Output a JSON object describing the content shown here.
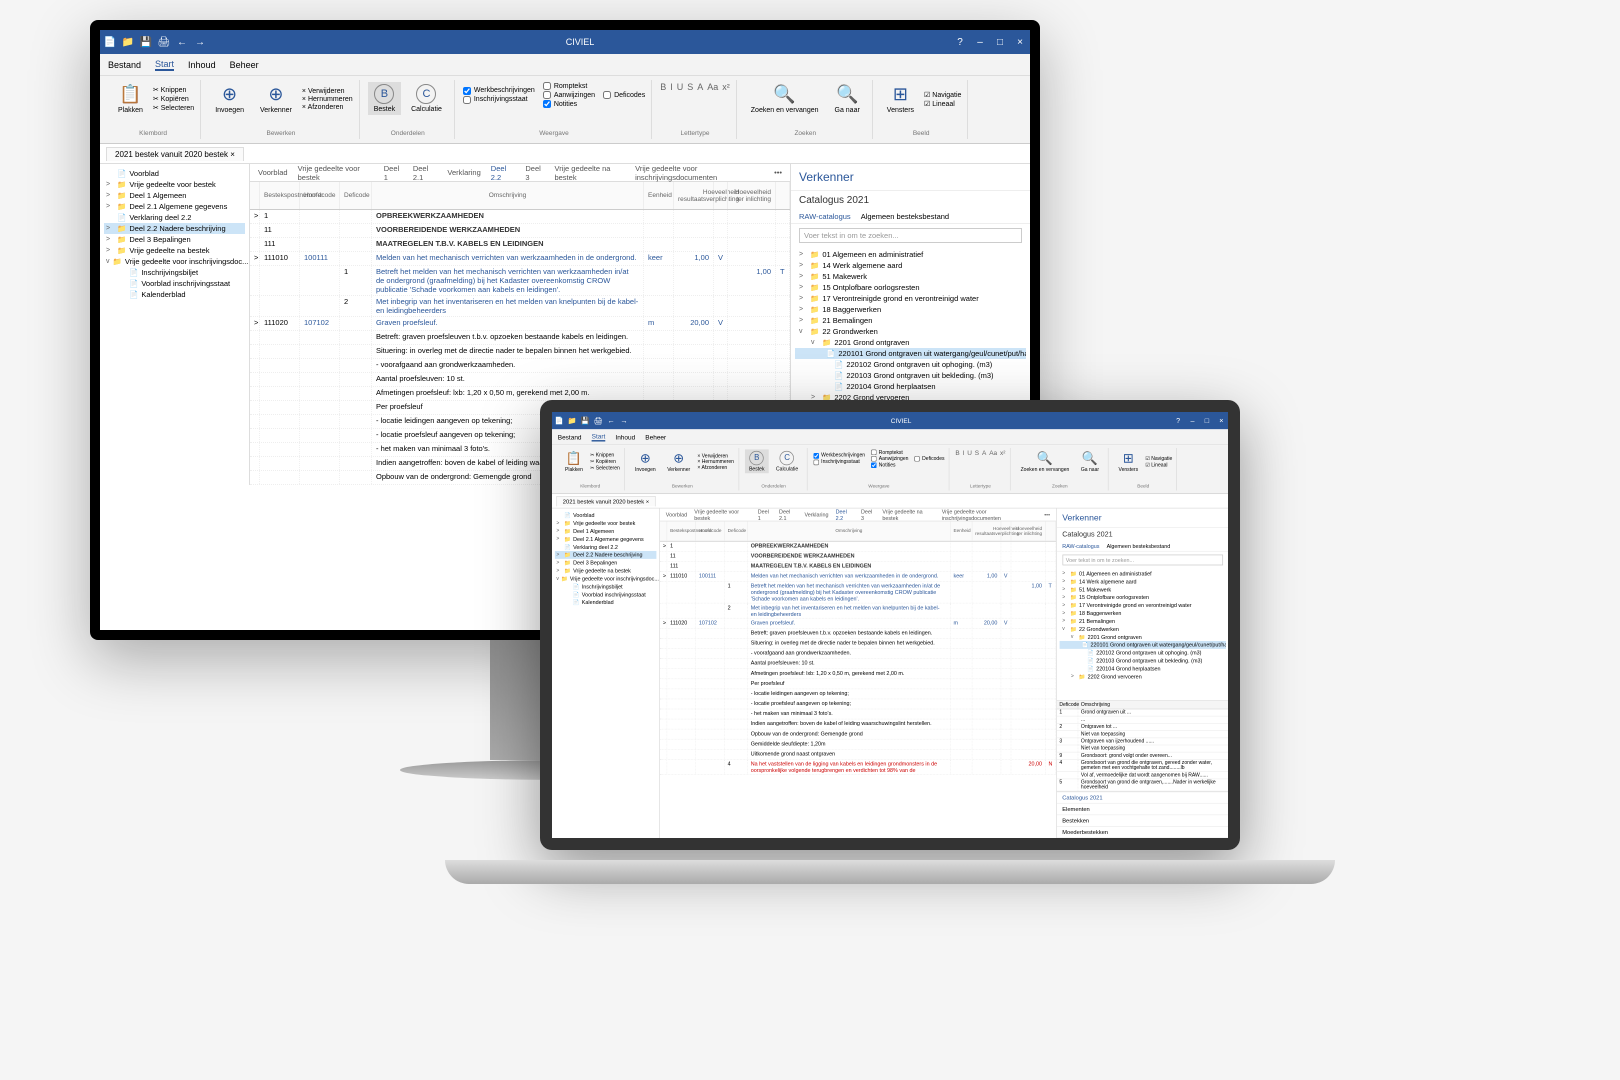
{
  "app_title": "CIVIEL",
  "titlebar_icons": [
    "file-icon",
    "folder-icon",
    "save-icon",
    "print-icon",
    "divider",
    "undo-icon",
    "redo-icon"
  ],
  "titlebar_right_icons": [
    "help-icon",
    "minimize-icon",
    "maximize-icon",
    "close-icon"
  ],
  "menu": {
    "items": [
      "Bestand",
      "Start",
      "Inhoud",
      "Beheer"
    ],
    "active": "Start"
  },
  "ribbon": {
    "groups": [
      {
        "name": "Klembord",
        "label": "Plakken",
        "items": [
          "Knippen",
          "Kopiëren",
          "Selecteren"
        ]
      },
      {
        "name": "Bewerken",
        "btns": [
          "Invoegen",
          "Verkenner"
        ],
        "items": [
          "Verwijderen",
          "Hernummeren",
          "Afzonderen"
        ]
      },
      {
        "name": "Onderdelen",
        "btns": [
          {
            "l": "Bestek",
            "circ": "B"
          },
          {
            "l": "Calculatie",
            "circ": "C"
          }
        ]
      },
      {
        "name": "Weergave",
        "checks_col1": [
          {
            "l": "Werkbeschrijvingen",
            "c": true
          },
          {
            "l": "Inschrijvingsstaat",
            "c": false
          }
        ],
        "checks_col2": [
          {
            "l": "Romptekst",
            "c": false
          },
          {
            "l": "Aanwijzingen",
            "c": false
          },
          {
            "l": "Notities",
            "c": true
          }
        ],
        "checks_col3": [
          {
            "l": "Deficodes",
            "c": false
          }
        ]
      },
      {
        "name": "Lettertype",
        "icons": [
          "B",
          "I",
          "U",
          "S",
          "A",
          "Aa",
          "x²"
        ]
      },
      {
        "name": "Zoeken",
        "btns": [
          "Zoeken en vervangen",
          "Ga naar"
        ]
      },
      {
        "name": "Beeld",
        "btn": "Vensters",
        "items": [
          "Navigatie",
          "Lineaal"
        ]
      }
    ]
  },
  "doc_tab": "2021 bestek vanuit 2020 bestek",
  "left_tree": [
    {
      "t": "Voorblad",
      "i": "file"
    },
    {
      "t": "Vrije gedeelte voor bestek",
      "i": "folder",
      "c": ">"
    },
    {
      "t": "Deel 1 Algemeen",
      "i": "folder",
      "c": ">"
    },
    {
      "t": "Deel 2.1 Algemene gegevens",
      "i": "folder",
      "c": ">"
    },
    {
      "t": "Verklaring deel 2.2",
      "i": "file"
    },
    {
      "t": "Deel 2.2 Nadere beschrijving",
      "i": "folder",
      "c": ">",
      "sel": true
    },
    {
      "t": "Deel 3 Bepalingen",
      "i": "folder",
      "c": ">"
    },
    {
      "t": "Vrije gedeelte na bestek",
      "i": "folder",
      "c": ">"
    },
    {
      "t": "Vrije gedeelte voor inschrijvingsdoc...",
      "i": "folder",
      "c": "v"
    },
    {
      "t": "Inschrijvingsbiljet",
      "i": "file",
      "sub": true
    },
    {
      "t": "Voorblad inschrijvingsstaat",
      "i": "file",
      "sub": true
    },
    {
      "t": "Kalenderblad",
      "i": "file",
      "sub": true
    }
  ],
  "section_tabs": [
    "Voorblad",
    "Vrije gedeelte voor bestek",
    "Deel 1",
    "Deel 2.1",
    "Verklaring",
    "Deel 2.2",
    "Deel 3",
    "Vrije gedeelte na bestek",
    "Vrije gedeelte voor inschrijvingsdocumenten",
    "•••"
  ],
  "section_active": "Deel 2.2",
  "grid_headers": {
    "c1": "Bestekspostnummer",
    "c2": "Hoofdcode",
    "c3": "Deficode",
    "c4": "Omschrijving",
    "c5": "Eenheid",
    "c6": "Hoeveelheid resultaatsverplichting",
    "c7": "Hoeveelheid ter inlichting"
  },
  "grid_rows": [
    {
      "chev": ">",
      "p": "1",
      "desc": "OPBREEKWERKZAAMHEDEN",
      "head": true
    },
    {
      "p": "11",
      "desc": "VOORBEREIDENDE WERKZAAMHEDEN",
      "head": true
    },
    {
      "p": "111",
      "desc": "MAATREGELEN T.B.V. KABELS EN LEIDINGEN",
      "head": true
    },
    {
      "chev": ">",
      "p": "111010",
      "h": "100111",
      "desc": "Melden van het mechanisch verrichten van werkzaamheden in de ondergrond.",
      "unit": "keer",
      "qty": "1,00",
      "f": "V",
      "blue": true
    },
    {
      "sub": "1",
      "desc": "Betreft het melden van het mechanisch verrichten van werkzaamheden in/at de ondergrond (graafmelding) bij het Kadaster overeenkomstig CROW publicatie 'Schade voorkomen aan kabels en leidingen'.",
      "qty2": "1,00",
      "f2": "T",
      "blue": true
    },
    {
      "sub": "2",
      "desc": "Met inbegrip van het inventariseren en het melden van knelpunten bij de kabel- en leidingbeheerders",
      "blue": true
    },
    {
      "chev": ">",
      "p": "111020",
      "h": "107102",
      "desc": "Graven proefsleuf.",
      "unit": "m",
      "qty": "20,00",
      "f": "V",
      "blue": true
    },
    {
      "desc": "Betreft: graven proefsleuven t.b.v. opzoeken bestaande kabels en leidingen."
    },
    {
      "desc": "Situering: in overleg met de directie nader te bepalen binnen het werkgebied."
    },
    {
      "desc": "- voorafgaand aan grondwerkzaamheden."
    },
    {
      "desc": "Aantal proefsleuven: 10 st."
    },
    {
      "desc": "Afmetingen proefsleuf: lxb: 1,20 x 0,50 m, gerekend met 2,00 m."
    },
    {
      "desc": "Per proefsleuf"
    },
    {
      "desc": "- locatie leidingen aangeven op tekening;"
    },
    {
      "desc": "- locatie proefsleuf aangeven op tekening;"
    },
    {
      "desc": "- het maken van minimaal 3 foto's."
    },
    {
      "desc": "Indien aangetroffen: boven de kabel of leiding waarschuwingslint herstellen."
    },
    {
      "desc": "Opbouw van de ondergrond: Gemengde grond"
    }
  ],
  "grid_rows_extra": [
    {
      "desc": "Gemiddelde sleufdiepte: 1,20m"
    },
    {
      "desc": "Uitkomende grond naast ontgraven"
    },
    {
      "sub": "4",
      "desc": "Na het vaststellen van de ligging van kabels en leidingen grondmonsters in de oorspronkelijke volgende terugbrengen en verdichten tot 98% van de",
      "qty2": "20,00",
      "f2": "N",
      "red": true
    }
  ],
  "right": {
    "title": "Verkenner",
    "subtitle": "Catalogus 2021",
    "tabs": [
      "RAW-catalogus",
      "Algemeen besteksbestand"
    ],
    "tab_active": "RAW-catalogus",
    "search_ph": "Voer tekst in om te zoeken...",
    "tree": [
      {
        "l": 1,
        "c": ">",
        "i": "folder",
        "t": "01  Algemeen en administratief"
      },
      {
        "l": 1,
        "c": ">",
        "i": "folder",
        "t": "14  Werk algemene aard"
      },
      {
        "l": 1,
        "c": ">",
        "i": "folder",
        "t": "51  Makewerk"
      },
      {
        "l": 1,
        "c": ">",
        "i": "folder",
        "t": "15  Ontplofbare oorlogsresten"
      },
      {
        "l": 1,
        "c": ">",
        "i": "folder",
        "t": "17  Verontreinigde grond en verontreinigd water"
      },
      {
        "l": 1,
        "c": ">",
        "i": "folder",
        "t": "18  Baggerwerken"
      },
      {
        "l": 1,
        "c": ">",
        "i": "folder",
        "t": "21  Bemalingen"
      },
      {
        "l": 1,
        "c": "v",
        "i": "folder",
        "t": "22  Grondwerken"
      },
      {
        "l": 2,
        "c": "v",
        "i": "folder",
        "t": "2201  Grond ontgraven"
      },
      {
        "l": 3,
        "i": "file",
        "t": "220101  Grond ontgraven uit watergang/geul/cunet/put/haven. (m3)",
        "sel": true
      },
      {
        "l": 3,
        "i": "file",
        "t": "220102  Grond ontgraven uit ophoging. (m3)"
      },
      {
        "l": 3,
        "i": "file",
        "t": "220103  Grond ontgraven uit bekleding. (m3)"
      },
      {
        "l": 3,
        "i": "file",
        "t": "220104  Grond herplaatsen"
      },
      {
        "l": 2,
        "c": ">",
        "i": "folder",
        "t": "2202  Grond vervoeren"
      }
    ],
    "bottom_sections": [
      "Catalogus 2021",
      "Elementen",
      "Bestekken",
      "Moederbestekken"
    ],
    "detail_header": [
      "Deficode",
      "Omschrijving"
    ],
    "detail_rows": [
      {
        "c": "1",
        "t": "Grond ontgraven uit ..."
      },
      {
        "c": "",
        "t": "..."
      },
      {
        "c": "2",
        "t": "Ontgraven tot ..."
      },
      {
        "c": "",
        "t": "Niet van toepassing"
      },
      {
        "c": "3",
        "t": "Ontgraven van ijzerhoudend ......"
      },
      {
        "c": "",
        "t": "Niet van toepassing"
      },
      {
        "c": "9",
        "t": "Grondsoort: grond volgt onder overeen..."
      },
      {
        "c": "4",
        "t": "Grondsoort van grond die ontgraven, gereed zonder water, gemeten met een vochtgehalte tot zand........lb"
      },
      {
        "c": "",
        "t": "Vol af, vermoedelijke dat wordt aangenomen bij RAW......"
      },
      {
        "c": "5",
        "t": "Grondsoort van grond die ontgraven,.......Nader in werkelijke hoeveelheid"
      }
    ]
  }
}
